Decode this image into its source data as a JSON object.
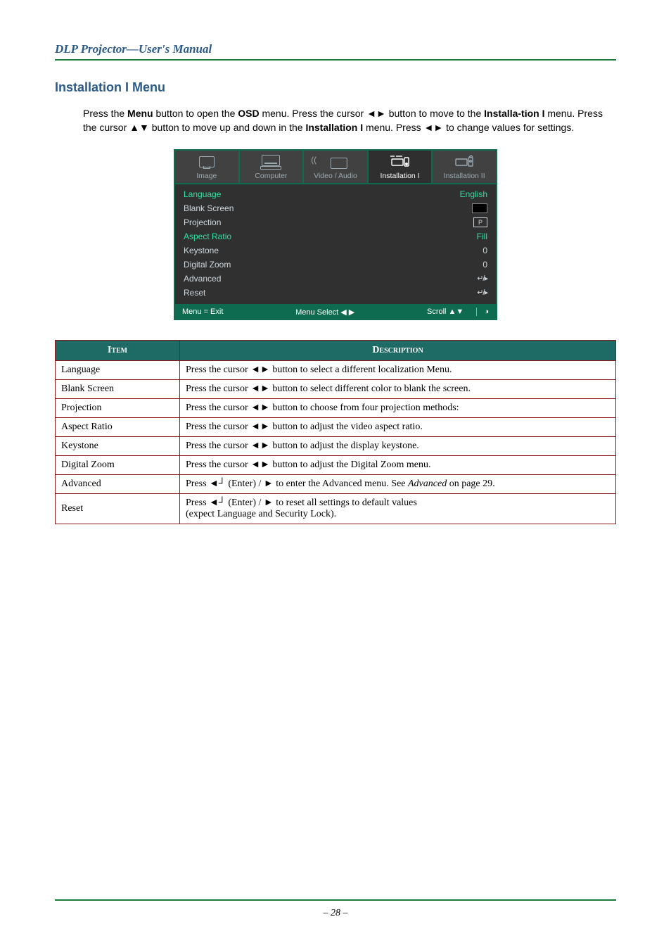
{
  "header": "DLP Projector—User's Manual",
  "section_title": "Installation I Menu",
  "intro_parts": {
    "p1": "Press the ",
    "b1": "Menu",
    "p2": " button to open the ",
    "b2": "OSD",
    "p3": " menu. Press the cursor ◄► button to move to the ",
    "b3": "Installa-tion I",
    "p4": " menu. Press the cursor ▲▼ button to move up and down in the ",
    "b4": "Installation I",
    "p5": " menu. Press ◄► to change values for settings."
  },
  "osd": {
    "tabs": [
      "Image",
      "Computer",
      "Video / Audio",
      "Installation I",
      "Installation II"
    ],
    "active_tab_index": 3,
    "rows": [
      {
        "label": "Language",
        "value": "English",
        "hl": true
      },
      {
        "label": "Blank Screen",
        "value": "black"
      },
      {
        "label": "Projection",
        "value": "P"
      },
      {
        "label": "Aspect Ratio",
        "value": "Fill",
        "hl": true
      },
      {
        "label": "Keystone",
        "value": "0"
      },
      {
        "label": "Digital Zoom",
        "value": "0"
      },
      {
        "label": "Advanced",
        "value": "enter"
      },
      {
        "label": "Reset",
        "value": "enter"
      }
    ],
    "footer": {
      "left": "Menu = Exit",
      "mid": "Menu Select ◀ ▶",
      "right": "Scroll ▲▼"
    }
  },
  "table": {
    "head_item": "Item",
    "head_desc": "Description",
    "rows": [
      {
        "item": "Language",
        "desc": "Press the cursor ◄► button to select a different localization Menu."
      },
      {
        "item": "Blank Screen",
        "desc": "Press the cursor ◄► button to select different color to blank the screen."
      },
      {
        "item": "Projection",
        "desc": "Press the cursor ◄► button to choose from four projection methods:"
      },
      {
        "item": "Aspect Ratio",
        "desc": "Press the cursor ◄► button to adjust the video aspect ratio."
      },
      {
        "item": "Keystone",
        "desc": "Press the cursor ◄► button to adjust the display keystone."
      },
      {
        "item": "Digital Zoom",
        "desc": "Press the cursor ◄► button to adjust the Digital Zoom menu."
      },
      {
        "item": "Advanced",
        "desc_html": "Press ◄┘ (Enter) / ► to enter the Advanced menu. See <i>Advanced</i> on page 29."
      },
      {
        "item": "Reset",
        "desc": "Press ◄┘ (Enter) / ► to reset all settings to default values\n(expect Language and Security Lock)."
      }
    ]
  },
  "page_number": "– 28 –"
}
